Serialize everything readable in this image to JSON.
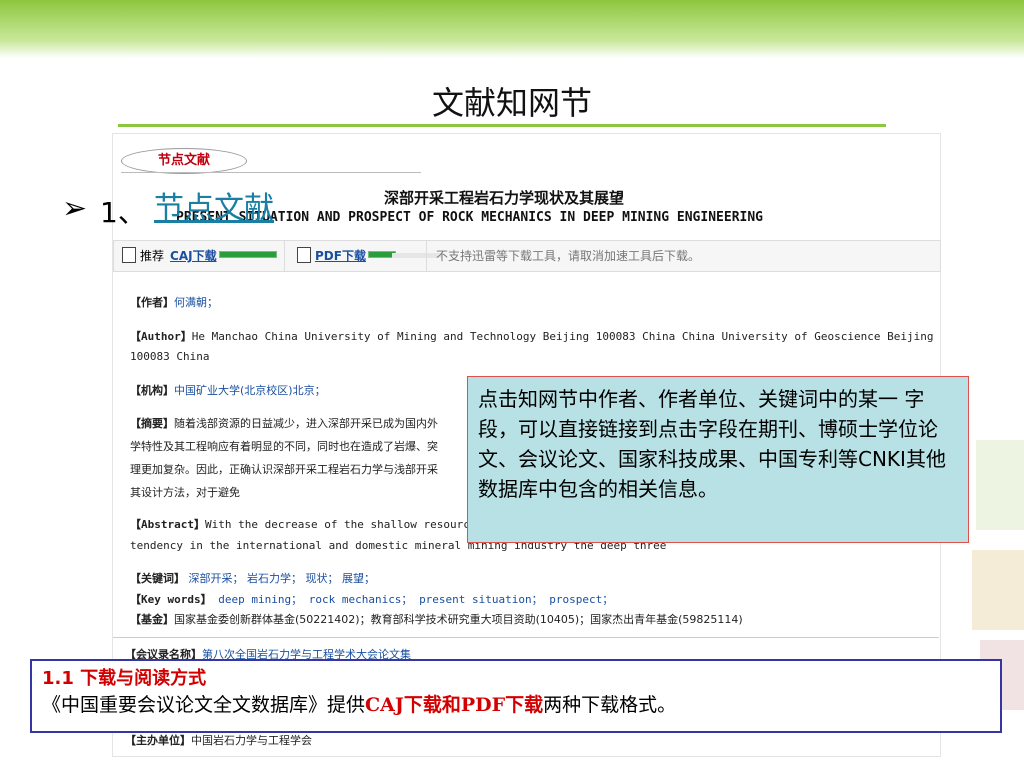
{
  "slide": {
    "title": "文献知网节",
    "bullet_arrow": "➢",
    "bullet_num": "1、",
    "bullet_link": "节点文献"
  },
  "screenshot": {
    "node_tab": "节点文献",
    "paper_title_cn": "深部开采工程岩石力学现状及其展望",
    "paper_title_en": "PRESENT SITUATION AND PROSPECT OF ROCK MECHANICS IN DEEP MINING ENGINEERING",
    "download_bar": {
      "recommend": "推荐",
      "caj_link": "CAJ下载",
      "pdf_link": "PDF下载",
      "notice": "不支持迅雷等下载工具，请取消加速工具后下载。"
    },
    "author_label": "【作者】",
    "author_value": "何满朝；",
    "author_en_label": "【Author】",
    "author_en_value": "He Manchao China University of Mining and Technology Beijing 100083 China China University of Geoscience Beijing",
    "author_en_value2": "100083 China",
    "org_label": "【机构】",
    "org_value": "中国矿业大学(北京校区)北京；",
    "abstract_label": "【摘要】",
    "abstract_line1": "随着浅部资源的日益减少，进入深部开采已成为国内外",
    "abstract_line2": "学特性及其工程响应有着明显的不同，同时也在造成了岩爆、突",
    "abstract_line3": "理更加复杂。因此，正确认识深部开采工程岩石力学与浅部开采",
    "abstract_line4": "其设计方法，对于避免",
    "abstract_en_label": "【Abstract】",
    "abstract_en_line1": "With the decrease of the shallow resources",
    "abstract_en_line2": "tendency in the international and domestic mineral mining industry the deep  three",
    "keywords_label": "【关键词】",
    "keywords": [
      "深部开采；",
      "岩石力学；",
      "现状；",
      "展望；"
    ],
    "keywords_en_label": "【Key words】",
    "keywords_en": [
      "deep mining；",
      "rock mechanics；",
      "present situation；",
      "prospect；"
    ],
    "fund_label": "【基金】",
    "fund_value": "国家基金委创新群体基金(50221402)；教育部科学技术研究重大项目资助(10405)；国家杰出青年基金(59825114)",
    "conference_label": "【会议录名称】",
    "conference_value": "第八次全国岩石力学与工程学术大会论文集",
    "organizer_label": "【主办单位】",
    "organizer_value": "中国岩石力学与工程学会"
  },
  "callout": {
    "text": "点击知网节中作者、作者单位、关键词中的某一 字段，可以直接链接到点击字段在期刊、博硕士学位论文、会议论文、国家科技成果、中国专利等CNKI其他数据库中包含的相关信息。"
  },
  "note": {
    "heading": "1.1 下载与阅读方式",
    "body_prefix": "《中国重要会议论文全文数据库》提供",
    "body_highlight": "CAJ下载和PDF下载",
    "body_suffix": "两种下载格式。"
  },
  "colors": {
    "accent_green": "#8dc63f",
    "link_blue": "#1a4fa0",
    "highlight_red": "#d20000",
    "callout_bg": "#b7e1e5",
    "note_border": "#3535a3"
  }
}
